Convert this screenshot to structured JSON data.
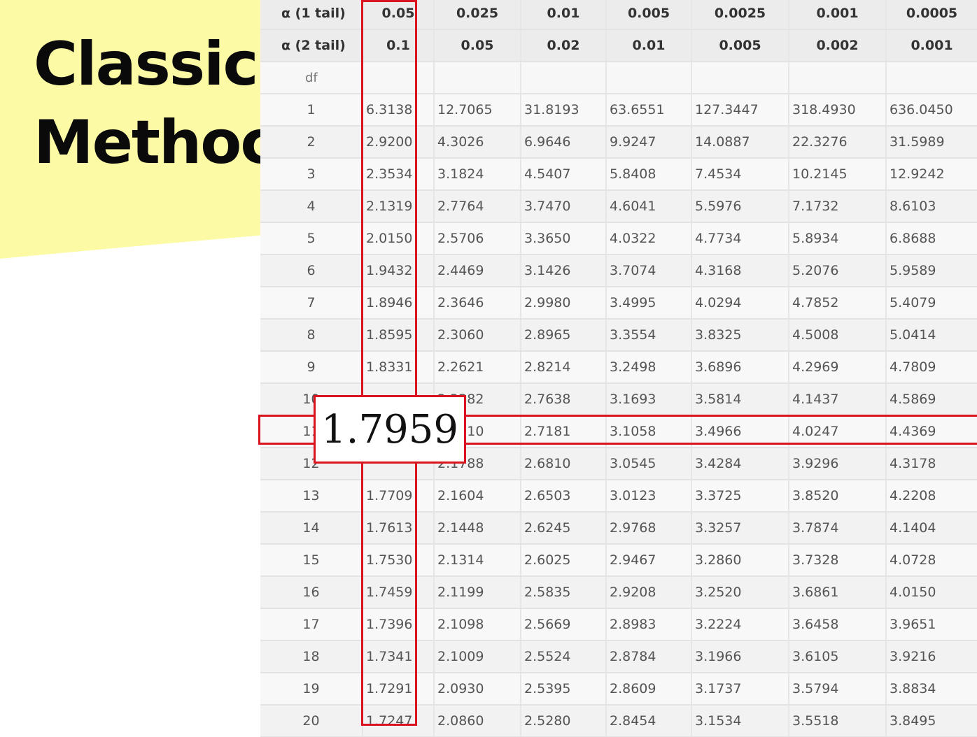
{
  "slide": {
    "title_line1": "Classic",
    "title_line2": "Methoc",
    "accent_color": "#fdfaa5"
  },
  "table": {
    "alpha1_label": "α (1 tail)",
    "alpha2_label": "α (2 tail)",
    "df_label": "df",
    "alpha1": [
      "0.05",
      "0.025",
      "0.01",
      "0.005",
      "0.0025",
      "0.001",
      "0.0005"
    ],
    "alpha2": [
      "0.1",
      "0.05",
      "0.02",
      "0.01",
      "0.005",
      "0.002",
      "0.001"
    ],
    "rows": [
      {
        "df": "1",
        "v": [
          "6.3138",
          "12.7065",
          "31.8193",
          "63.6551",
          "127.3447",
          "318.4930",
          "636.0450"
        ]
      },
      {
        "df": "2",
        "v": [
          "2.9200",
          "4.3026",
          "6.9646",
          "9.9247",
          "14.0887",
          "22.3276",
          "31.5989"
        ]
      },
      {
        "df": "3",
        "v": [
          "2.3534",
          "3.1824",
          "4.5407",
          "5.8408",
          "7.4534",
          "10.2145",
          "12.9242"
        ]
      },
      {
        "df": "4",
        "v": [
          "2.1319",
          "2.7764",
          "3.7470",
          "4.6041",
          "5.5976",
          "7.1732",
          "8.6103"
        ]
      },
      {
        "df": "5",
        "v": [
          "2.0150",
          "2.5706",
          "3.3650",
          "4.0322",
          "4.7734",
          "5.8934",
          "6.8688"
        ]
      },
      {
        "df": "6",
        "v": [
          "1.9432",
          "2.4469",
          "3.1426",
          "3.7074",
          "4.3168",
          "5.2076",
          "5.9589"
        ]
      },
      {
        "df": "7",
        "v": [
          "1.8946",
          "2.3646",
          "2.9980",
          "3.4995",
          "4.0294",
          "4.7852",
          "5.4079"
        ]
      },
      {
        "df": "8",
        "v": [
          "1.8595",
          "2.3060",
          "2.8965",
          "3.3554",
          "3.8325",
          "4.5008",
          "5.0414"
        ]
      },
      {
        "df": "9",
        "v": [
          "1.8331",
          "2.2621",
          "2.8214",
          "3.2498",
          "3.6896",
          "4.2969",
          "4.7809"
        ]
      },
      {
        "df": "10",
        "v": [
          "",
          "2.2282",
          "2.7638",
          "3.1693",
          "3.5814",
          "4.1437",
          "4.5869"
        ]
      },
      {
        "df": "11",
        "v": [
          "",
          "2.2010",
          "2.7181",
          "3.1058",
          "3.4966",
          "4.0247",
          "4.4369"
        ]
      },
      {
        "df": "12",
        "v": [
          "",
          "2.1788",
          "2.6810",
          "3.0545",
          "3.4284",
          "3.9296",
          "4.3178"
        ]
      },
      {
        "df": "13",
        "v": [
          "1.7709",
          "2.1604",
          "2.6503",
          "3.0123",
          "3.3725",
          "3.8520",
          "4.2208"
        ]
      },
      {
        "df": "14",
        "v": [
          "1.7613",
          "2.1448",
          "2.6245",
          "2.9768",
          "3.3257",
          "3.7874",
          "4.1404"
        ]
      },
      {
        "df": "15",
        "v": [
          "1.7530",
          "2.1314",
          "2.6025",
          "2.9467",
          "3.2860",
          "3.7328",
          "4.0728"
        ]
      },
      {
        "df": "16",
        "v": [
          "1.7459",
          "2.1199",
          "2.5835",
          "2.9208",
          "3.2520",
          "3.6861",
          "4.0150"
        ]
      },
      {
        "df": "17",
        "v": [
          "1.7396",
          "2.1098",
          "2.5669",
          "2.8983",
          "3.2224",
          "3.6458",
          "3.9651"
        ]
      },
      {
        "df": "18",
        "v": [
          "1.7341",
          "2.1009",
          "2.5524",
          "2.8784",
          "3.1966",
          "3.6105",
          "3.9216"
        ]
      },
      {
        "df": "19",
        "v": [
          "1.7291",
          "2.0930",
          "2.5395",
          "2.8609",
          "3.1737",
          "3.5794",
          "3.8834"
        ]
      },
      {
        "df": "20",
        "v": [
          "1.7247",
          "2.0860",
          "2.5280",
          "2.8454",
          "3.1534",
          "3.5518",
          "3.8495"
        ]
      }
    ]
  },
  "callout": {
    "value": "1.7959",
    "highlight_color": "#d9141e"
  }
}
